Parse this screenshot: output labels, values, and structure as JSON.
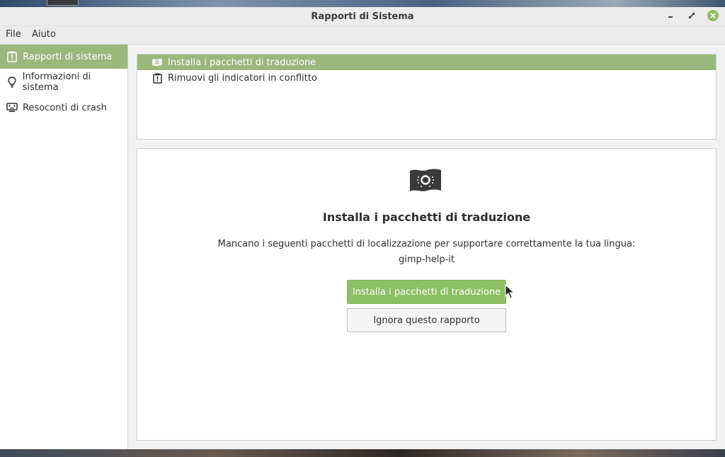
{
  "window": {
    "title": "Rapporti di Sistema",
    "controls": {
      "minimize": "minimize-icon",
      "maximize": "maximize-icon",
      "close": "close-icon"
    }
  },
  "menubar": {
    "items": [
      {
        "label": "File"
      },
      {
        "label": "Aiuto"
      }
    ]
  },
  "sidebar": {
    "items": [
      {
        "label": "Rapporti di sistema",
        "icon": "report-clipboard-icon",
        "active": true
      },
      {
        "label": "Informazioni di sistema",
        "icon": "lightbulb-icon",
        "active": false
      },
      {
        "label": "Resoconti di crash",
        "icon": "crash-monitor-icon",
        "active": false
      }
    ]
  },
  "reports": {
    "items": [
      {
        "label": "Installa i pacchetti di traduzione",
        "icon": "flag-icon",
        "selected": true
      },
      {
        "label": "Rimuovi gli indicatori in conflitto",
        "icon": "report-clipboard-icon",
        "selected": false
      }
    ]
  },
  "detail": {
    "icon": "flag-icon",
    "title": "Installa i pacchetti di traduzione",
    "description": "Mancano i seguenti pacchetti di localizzazione per supportare correttamente la tua lingua:",
    "packages": "gimp-help-it",
    "primary_button": "Installa i pacchetti di traduzione",
    "secondary_button": "Ignora questo rapporto"
  },
  "colors": {
    "accent": "#8cc063",
    "selection": "#9ab87c"
  }
}
